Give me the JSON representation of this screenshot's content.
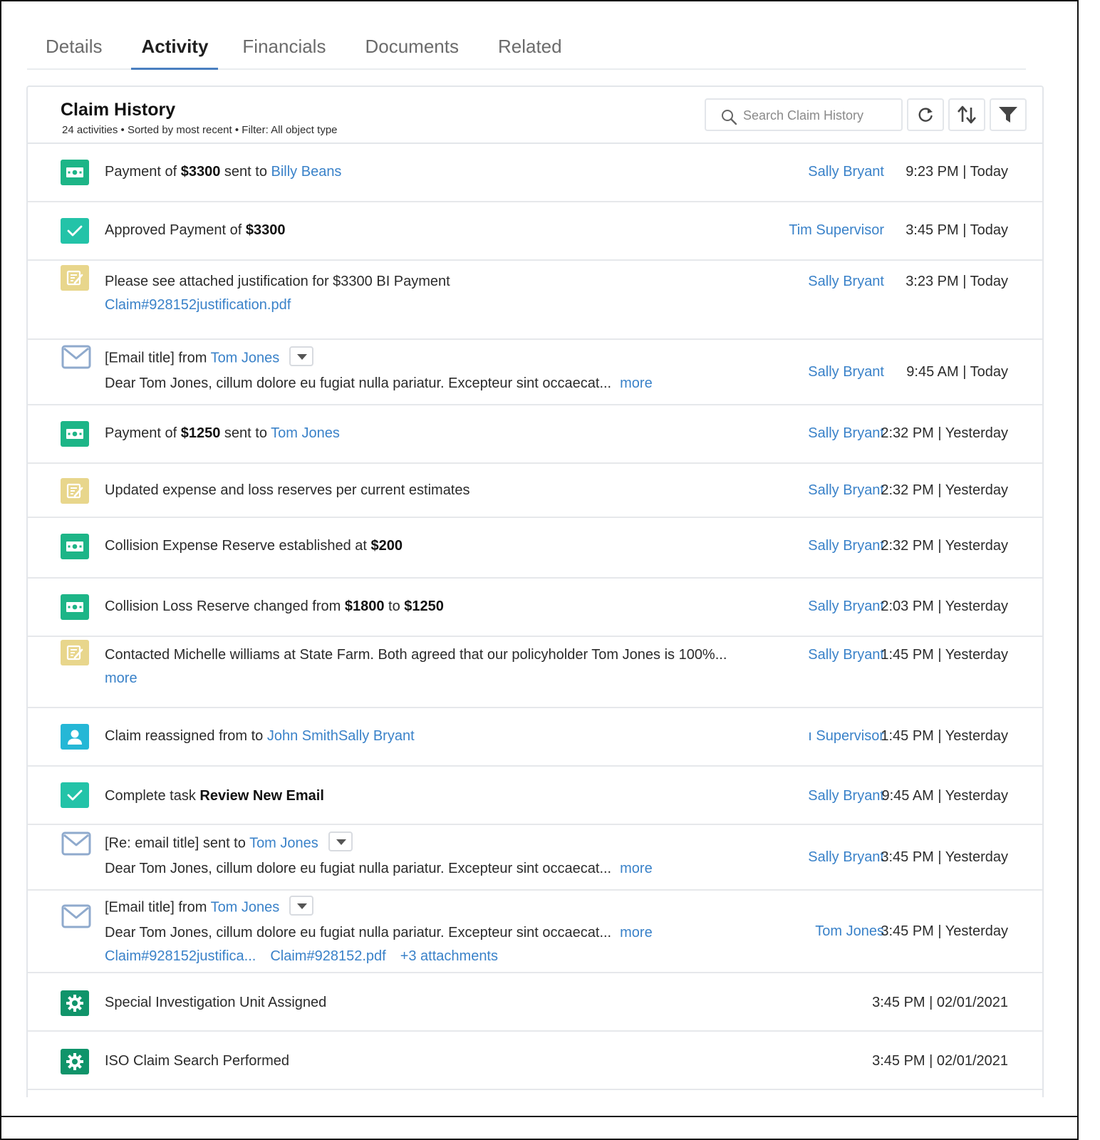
{
  "tabs": [
    {
      "label": "Details"
    },
    {
      "label": "Activity"
    },
    {
      "label": "Financials"
    },
    {
      "label": "Documents"
    },
    {
      "label": "Related"
    }
  ],
  "claim_history": {
    "title": "Claim History",
    "subtitle": "24 activities • Sorted by most recent • Filter: All object type",
    "search_placeholder": "Search Claim History"
  },
  "activities": [
    {
      "icon": "money-icon",
      "t1": "Payment of ",
      "b1": "$3300",
      "t2": " sent to ",
      "l1": "Billy Beans",
      "user": "Sally Bryant",
      "time": "9:23 PM | Today"
    },
    {
      "icon": "check-icon",
      "t1": "Approved Payment of ",
      "b1": "$3300",
      "user": "Tim Supervisor",
      "time": "3:45 PM | Today"
    },
    {
      "icon": "note-icon",
      "t1": "Please see attached justification for $3300 BI Payment",
      "attachment": "Claim#928152justification.pdf",
      "user": "Sally Bryant",
      "time": "3:23 PM | Today"
    },
    {
      "icon": "email-icon",
      "t1": "[Email title] from ",
      "l1": "Tom Jones",
      "body": "Dear Tom Jones, cillum dolore eu fugiat nulla pariatur. Excepteur sint occaecat...",
      "more": "more",
      "user": "Sally Bryant",
      "time": "9:45 AM | Today"
    },
    {
      "icon": "money-icon",
      "t1": "Payment of ",
      "b1": "$1250",
      "t2": " sent to ",
      "l1": "Tom Jones",
      "user": "Sally Bryant",
      "time": "2:32 PM | Yesterday"
    },
    {
      "icon": "note-icon",
      "t1": "Updated expense and loss reserves per current estimates",
      "user": "Sally Bryant",
      "time": "2:32 PM | Yesterday"
    },
    {
      "icon": "money-icon",
      "t1": "Collision Expense Reserve established at ",
      "b1": "$200",
      "user": "Sally Bryant",
      "time": "2:32 PM | Yesterday"
    },
    {
      "icon": "money-icon",
      "t1": "Collision Loss Reserve changed from ",
      "b1": "$1800",
      "t2": " to ",
      "b2": "$1250",
      "user": "Sally Bryant",
      "time": "2:03 PM | Yesterday"
    },
    {
      "icon": "note-icon",
      "t1": "Contacted Michelle williams at State Farm. Both agreed that our policyholder Tom Jones is 100%...",
      "more": "more",
      "user": "Sally Bryant",
      "time": "1:45 PM | Yesterday"
    },
    {
      "icon": "person-icon",
      "t1": "Claim reassigned from ",
      "l1": "John Smith",
      "t2": " to ",
      "l2": "Sally Bryant",
      "user": "ı Supervisor",
      "time": "1:45 PM | Yesterday"
    },
    {
      "icon": "check-icon",
      "t1": "Complete task ",
      "b1": "Review New Email",
      "user": "Sally Bryant",
      "time": "9:45 AM | Yesterday"
    },
    {
      "icon": "email-icon",
      "t1": "[Re: email title] sent to ",
      "l1": "Tom Jones",
      "body": "Dear Tom Jones, cillum dolore eu fugiat nulla pariatur. Excepteur sint occaecat...",
      "more": "more",
      "user": "Sally Bryant",
      "time": "3:45 PM | Yesterday"
    },
    {
      "icon": "email-icon",
      "t1": "[Email title] from ",
      "l1": "Tom Jones",
      "body": "Dear Tom Jones, cillum dolore eu fugiat nulla pariatur. Excepteur sint occaecat...",
      "more": "more",
      "attachments": [
        "Claim#928152justifica...",
        "Claim#928152.pdf",
        "+3 attachments"
      ],
      "user": "Tom Jones",
      "time": "3:45 PM | Yesterday"
    },
    {
      "icon": "gear-icon",
      "t1": "Special Investigation Unit Assigned",
      "time": "3:45 PM | 02/01/2021"
    },
    {
      "icon": "gear-icon",
      "t1": "ISO Claim Search Performed",
      "time": "3:45 PM | 02/01/2021"
    }
  ]
}
